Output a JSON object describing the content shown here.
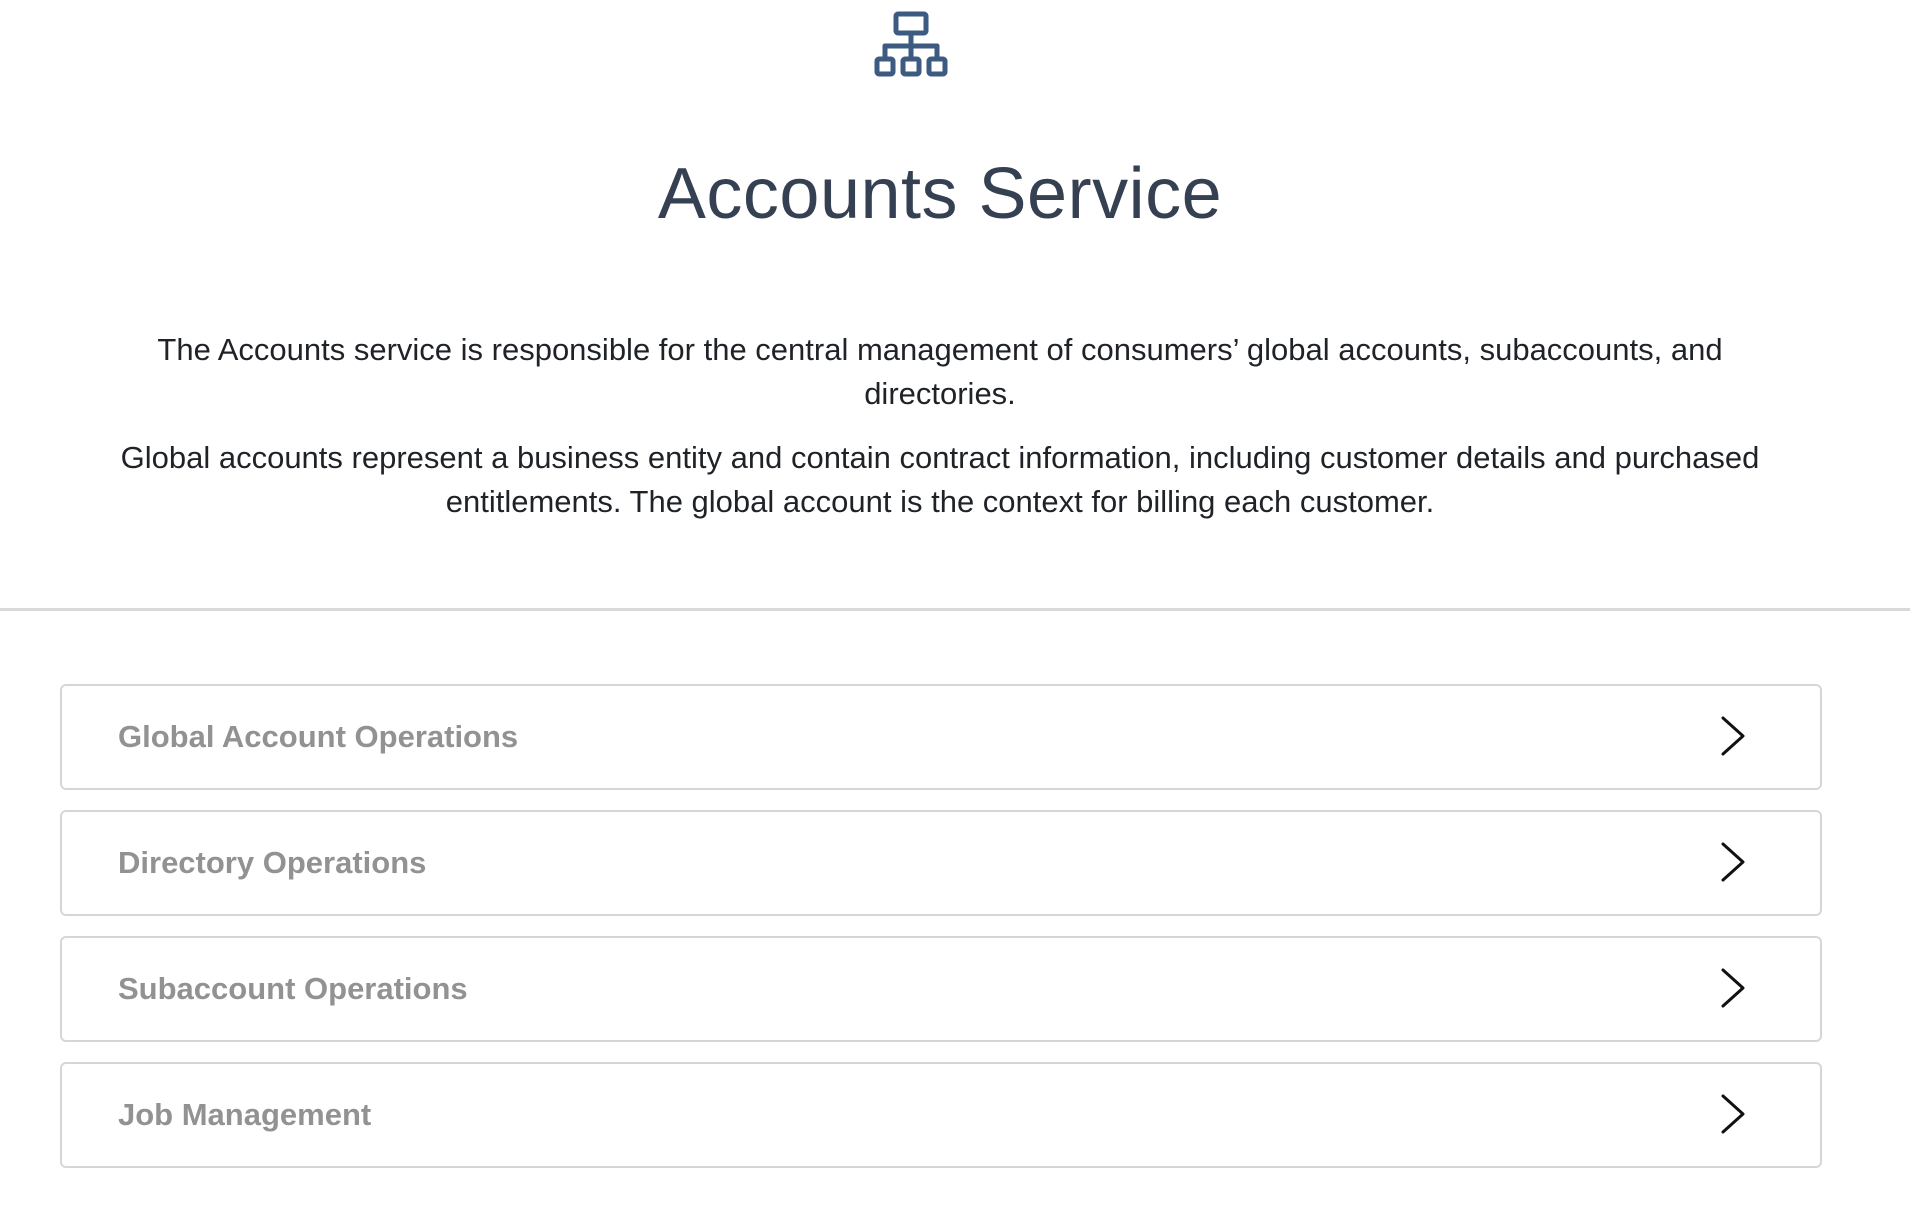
{
  "page": {
    "title": "Accounts Service",
    "icon": "hierarchy-icon",
    "description": [
      "The Accounts service is responsible for the central management of consumers’ global accounts, subaccounts, and directories.",
      "Global accounts represent a business entity and contain contract information, including customer details and purchased entitlements. The global account is the context for billing each customer."
    ]
  },
  "operations": [
    {
      "label": "Global Account Operations",
      "icon": "chevron-right-icon"
    },
    {
      "label": "Directory Operations",
      "icon": "chevron-right-icon"
    },
    {
      "label": "Subaccount Operations",
      "icon": "chevron-right-icon"
    },
    {
      "label": "Job Management",
      "icon": "chevron-right-icon"
    }
  ],
  "colors": {
    "title": "#354052",
    "icon": "#3d5a80",
    "label": "#929292",
    "border": "#d6d6d6"
  }
}
